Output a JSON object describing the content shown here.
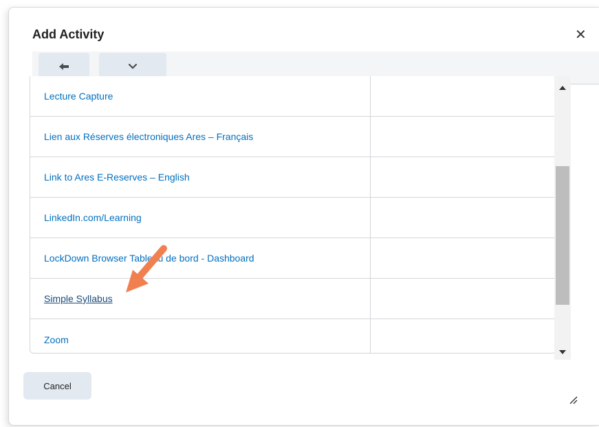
{
  "dialog": {
    "title": "Add Activity",
    "close_icon": "close-icon"
  },
  "toolbar": {
    "back_icon": "arrow-left-icon",
    "menu_icon": "chevron-down-icon"
  },
  "activities": [
    {
      "label": "Lecture Capture"
    },
    {
      "label": "Lien aux Réserves électroniques Ares – Français"
    },
    {
      "label": "Link to Ares E-Reserves – English"
    },
    {
      "label": "LinkedIn.com/Learning"
    },
    {
      "label": "LockDown Browser Tableau de bord - Dashboard"
    },
    {
      "label": "Simple Syllabus"
    },
    {
      "label": "Zoom"
    }
  ],
  "footer": {
    "cancel_label": "Cancel"
  },
  "colors": {
    "link": "#006fbf",
    "button_bg": "#e3e9f1",
    "annotation_arrow": "#f08050"
  }
}
